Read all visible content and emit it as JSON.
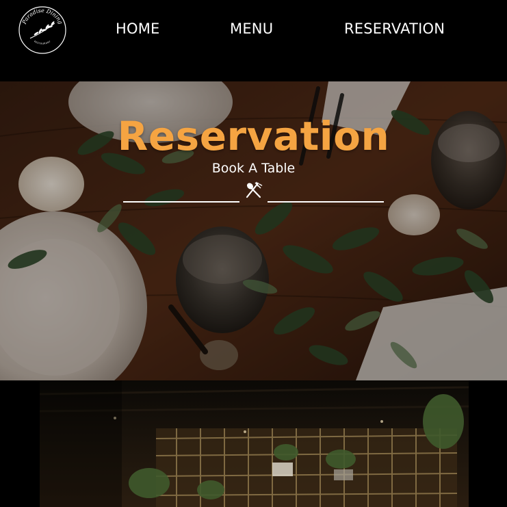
{
  "logo": {
    "text": "Paradise Dining",
    "tagline": "RESTAURANT",
    "icon": "olive-branch-icon"
  },
  "nav": {
    "items": [
      {
        "label": "HOME"
      },
      {
        "label": "MENU"
      },
      {
        "label": "RESERVATION"
      }
    ]
  },
  "hero": {
    "title": "Reservation",
    "subtitle": "Book A Table",
    "divider_icon": "fork-spoon-icon",
    "title_color": "#f5a442"
  },
  "colors": {
    "background": "#000000",
    "accent": "#f5a442",
    "text": "#ffffff"
  }
}
